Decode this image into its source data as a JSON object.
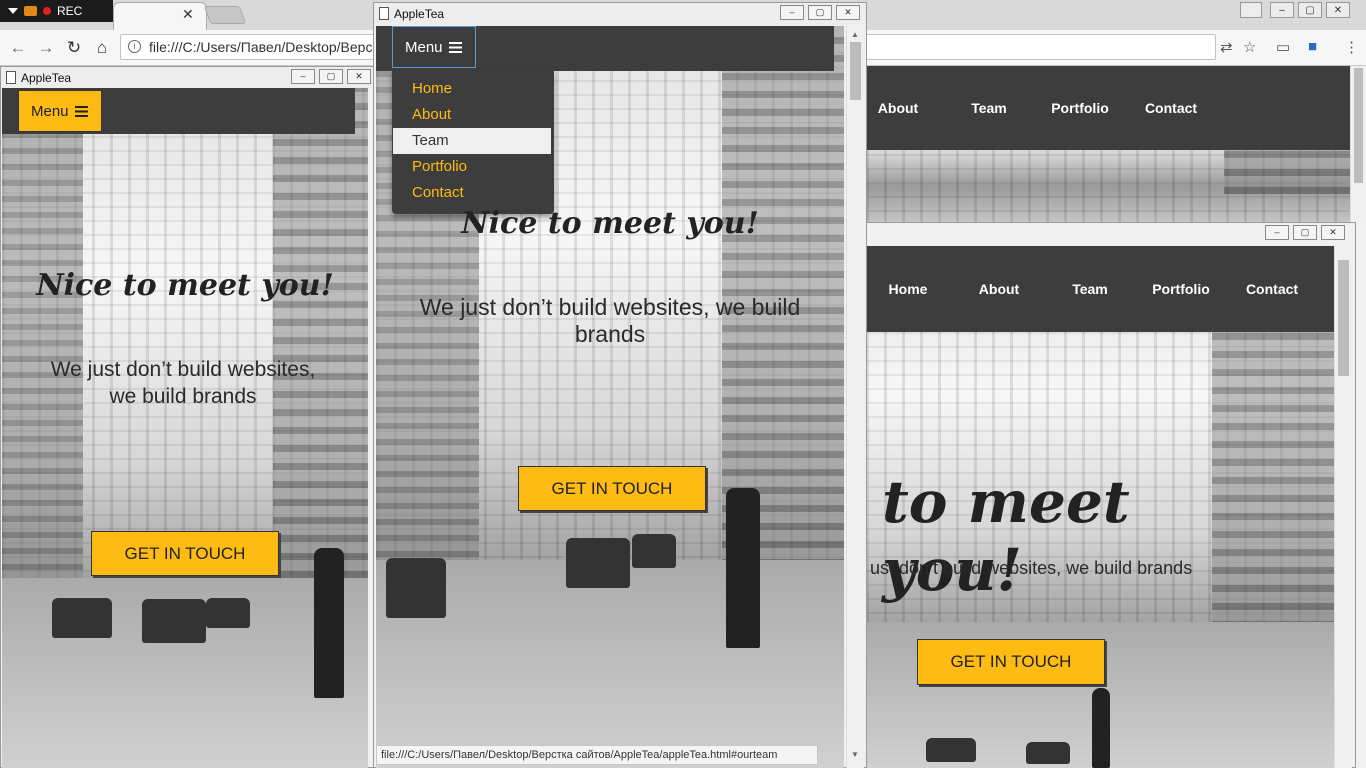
{
  "recorder": {
    "label": "REC"
  },
  "browser": {
    "address": "file:///C:/Users/Павел/Desktop/Верс",
    "window_controls": [
      "–",
      "▢",
      "✕"
    ]
  },
  "brand": {
    "yellow": "#fdbb14",
    "dark_bar": "#3d3d3d"
  },
  "icons": [
    "back-icon",
    "forward-icon",
    "reload-icon",
    "home-icon",
    "info-icon",
    "translate-icon",
    "star-icon",
    "cast-icon",
    "extension-icon",
    "kebab-icon",
    "menu-bars-icon",
    "document-icon"
  ],
  "left_window": {
    "title": "AppleTea",
    "menu_label": "Menu",
    "headline": "Nice to meet you!",
    "subline1": "We just don’t build websites,",
    "subline2": "we build brands",
    "cta": "GET IN TOUCH"
  },
  "middle_window": {
    "title": "AppleTea",
    "menu_label": "Menu",
    "menu_items": [
      "Home",
      "About",
      "Team",
      "Portfolio",
      "Contact"
    ],
    "active_item": "Team",
    "headline": "Nice to meet you!",
    "subline1": "We just don’t build websites, we build",
    "subline2": "brands",
    "cta": "GET IN TOUCH",
    "status_url": "file:///C:/Users/Павел/Desktop/Верстка сайтов/AppleTea/appleTea.html#ourteam"
  },
  "right_browser": {
    "nav": [
      "About",
      "Team",
      "Portfolio",
      "Contact"
    ]
  },
  "bottom_right_window": {
    "nav": [
      "Home",
      "About",
      "Team",
      "Portfolio",
      "Contact"
    ],
    "headline": "to meet you!",
    "subline": "ust don’t build websites, we build brands",
    "cta": "GET IN TOUCH"
  }
}
